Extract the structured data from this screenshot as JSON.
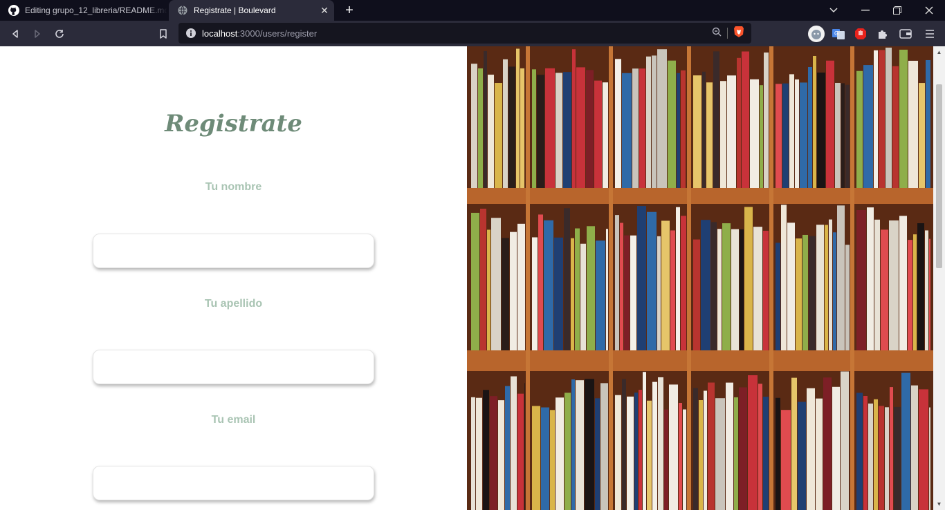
{
  "browser": {
    "tabs": [
      {
        "title": "Editing grupo_12_libreria/README.md",
        "icon": "github-icon",
        "active": false
      },
      {
        "title": "Registrate | Boulevard",
        "icon": "globe-icon",
        "active": true
      }
    ],
    "url_host": "localhost",
    "url_path": ":3000/users/register",
    "colors": {
      "tabstrip": "#0f0f1c",
      "toolbar": "#2b2b3a",
      "omnibox": "#15151f"
    }
  },
  "page": {
    "heading": "Registrate",
    "fields": [
      {
        "label": "Tu nombre",
        "value": "",
        "placeholder": ""
      },
      {
        "label": "Tu apellido",
        "value": "",
        "placeholder": ""
      },
      {
        "label": "Tu email",
        "value": "",
        "placeholder": ""
      }
    ],
    "colors": {
      "heading": "#6e8b78",
      "label": "#a9c4b3"
    },
    "image": {
      "subject": "bookshelf-photo"
    }
  }
}
